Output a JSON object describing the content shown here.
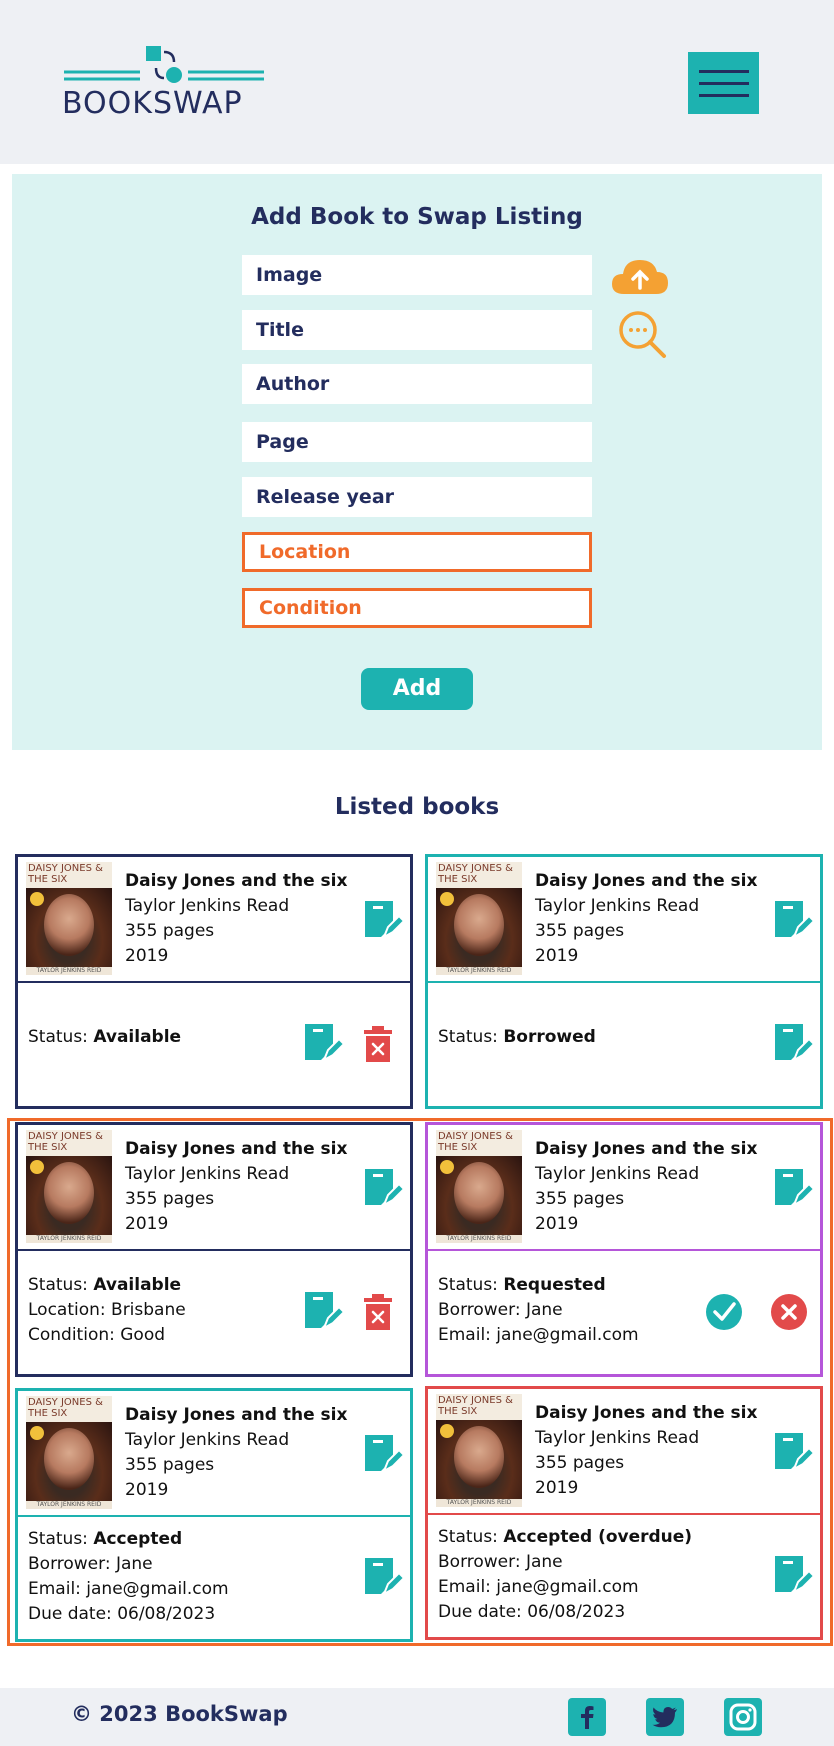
{
  "header": {
    "logo_text": "BOOKSWAP",
    "menu_icon": "hamburger-menu-icon"
  },
  "form": {
    "title": "Add Book to Swap Listing",
    "fields": {
      "image": "Image",
      "title": "Title",
      "author": "Author",
      "page": "Page",
      "release_year": "Release year",
      "location": "Location",
      "condition": "Condition"
    },
    "upload_icon": "cloud-upload-icon",
    "search_icon": "search-icon",
    "add_label": "Add"
  },
  "listed": {
    "title": "Listed books",
    "book": {
      "title": "Daisy Jones and the six",
      "author": "Taylor Jenkins Read",
      "pages": "355 pages",
      "year": "2019",
      "cover_title": "DAISY JONES & THE SIX",
      "cover_author": "TAYLOR JENKINS REID"
    },
    "status_prefix": "Status:",
    "cards": [
      {
        "status": "Available"
      },
      {
        "status": "Borrowed"
      },
      {
        "status": "Available",
        "location": "Location: Brisbane",
        "condition": "Condition: Good"
      },
      {
        "status": "Requested",
        "borrower": "Borrower: Jane",
        "email": "Email: jane@gmail.com"
      },
      {
        "status": "Accepted",
        "borrower": "Borrower: Jane",
        "email": "Email: jane@gmail.com",
        "due": "Due date: 06/08/2023"
      },
      {
        "status": "Accepted (overdue)",
        "borrower": "Borrower: Jane",
        "email": "Email: jane@gmail.com",
        "due": "Due date: 06/08/2023"
      }
    ]
  },
  "footer": {
    "copyright": "© 2023 BookSwap",
    "social": [
      "facebook-icon",
      "twitter-icon",
      "instagram-icon"
    ]
  },
  "colors": {
    "accent": "#1db2b0",
    "navy": "#232d5e",
    "orange": "#f06a2a",
    "purple": "#b556d9",
    "red": "#e24a4a",
    "upload_orange": "#f4a133"
  }
}
